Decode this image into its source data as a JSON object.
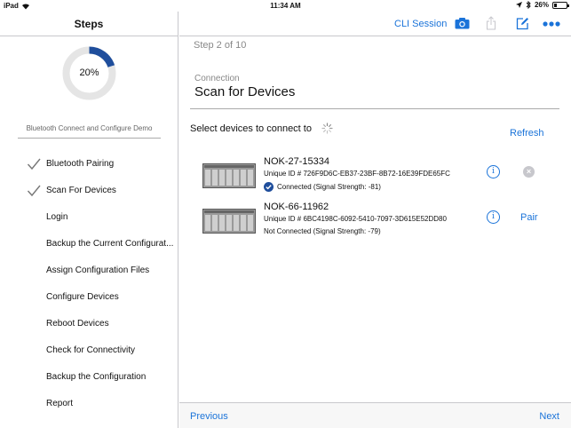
{
  "status_bar": {
    "device": "iPad",
    "time": "11:34 AM",
    "battery": "26%",
    "battery_level": 0.26
  },
  "sidebar": {
    "title": "Steps",
    "progress": {
      "percent": 20,
      "label": "20%"
    },
    "demo_title": "Bluetooth Connect and Configure Demo",
    "steps": [
      {
        "label": "Bluetooth Pairing",
        "done": true
      },
      {
        "label": "Scan For Devices",
        "done": true
      },
      {
        "label": "Login",
        "done": false
      },
      {
        "label": "Backup the Current Configurat...",
        "done": false
      },
      {
        "label": "Assign Configuration Files",
        "done": false
      },
      {
        "label": "Configure Devices",
        "done": false
      },
      {
        "label": "Reboot Devices",
        "done": false
      },
      {
        "label": "Check for Connectivity",
        "done": false
      },
      {
        "label": "Backup the Configuration",
        "done": false
      },
      {
        "label": "Report",
        "done": false
      }
    ]
  },
  "toolbar": {
    "cli_label": "CLI Session"
  },
  "main": {
    "step_count": "Step 2 of 10",
    "section_label": "Connection",
    "section_title": "Scan for Devices",
    "select_label": "Select devices to connect to",
    "refresh_label": "Refresh"
  },
  "devices": [
    {
      "name": "NOK-27-15334",
      "uid": "Unique ID # 726F9D6C-EB37-23BF-8B72-16E39FDE65FC",
      "status": "Connected (Signal Strength: -81)",
      "connected": true,
      "action": ""
    },
    {
      "name": "NOK-66-11962",
      "uid": "Unique ID # 6BC4198C-6092-5410-7097-3D615E52DD80",
      "status": "Not Connected (Signal Strength: -79)",
      "connected": false,
      "action": "Pair"
    }
  ],
  "footer": {
    "previous_label": "Previous",
    "next_label": "Next"
  },
  "colors": {
    "accent": "#1a73d9",
    "progress": "#1f4e9c",
    "ring_track": "#e5e5e5"
  }
}
